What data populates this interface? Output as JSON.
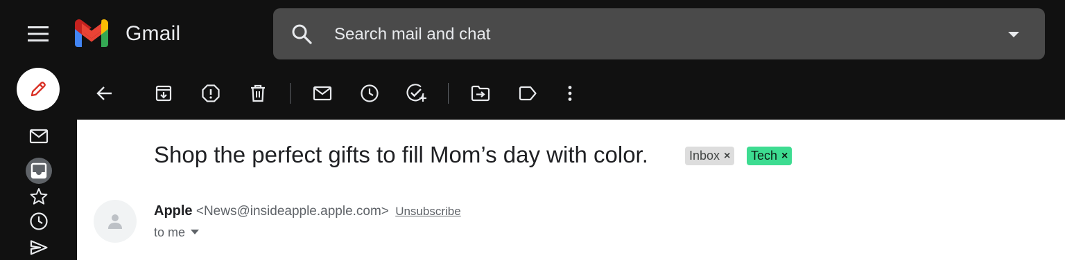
{
  "header": {
    "app_title": "Gmail",
    "icons": {
      "menu": "hamburger-menu-icon",
      "logo": "gmail-m-logo",
      "search": "search-icon",
      "options": "caret-down-icon"
    }
  },
  "search": {
    "placeholder": "Search mail and chat"
  },
  "compose": {
    "icon": "pencil-icon"
  },
  "toolbar": {
    "items": [
      "back-arrow-icon",
      "archive-icon",
      "report-spam-icon",
      "delete-icon",
      "mark-unread-icon",
      "snooze-icon",
      "add-to-tasks-icon",
      "move-to-icon",
      "label-icon",
      "more-vert-icon"
    ]
  },
  "rail": {
    "items": [
      "mail-icon",
      "inbox-icon",
      "star-icon",
      "clock-icon",
      "send-icon"
    ],
    "active": "inbox-icon"
  },
  "email": {
    "subject": "Shop the perfect gifts to fill Mom’s day with color.",
    "labels": [
      {
        "text": "Inbox",
        "bg": "#dddddd"
      },
      {
        "text": "Tech",
        "bg": "#3ddc91"
      }
    ],
    "label_remove": "×",
    "sender_name": "Apple",
    "sender_email": "<News@insideapple.apple.com>",
    "unsubscribe": "Unsubscribe",
    "recipient": "to me"
  },
  "colors": {
    "background": "#111111",
    "search_bg": "#4a4a4a",
    "content_bg": "#ffffff",
    "tech_label": "#3ddc91",
    "compose_pencil": "#d93025"
  }
}
